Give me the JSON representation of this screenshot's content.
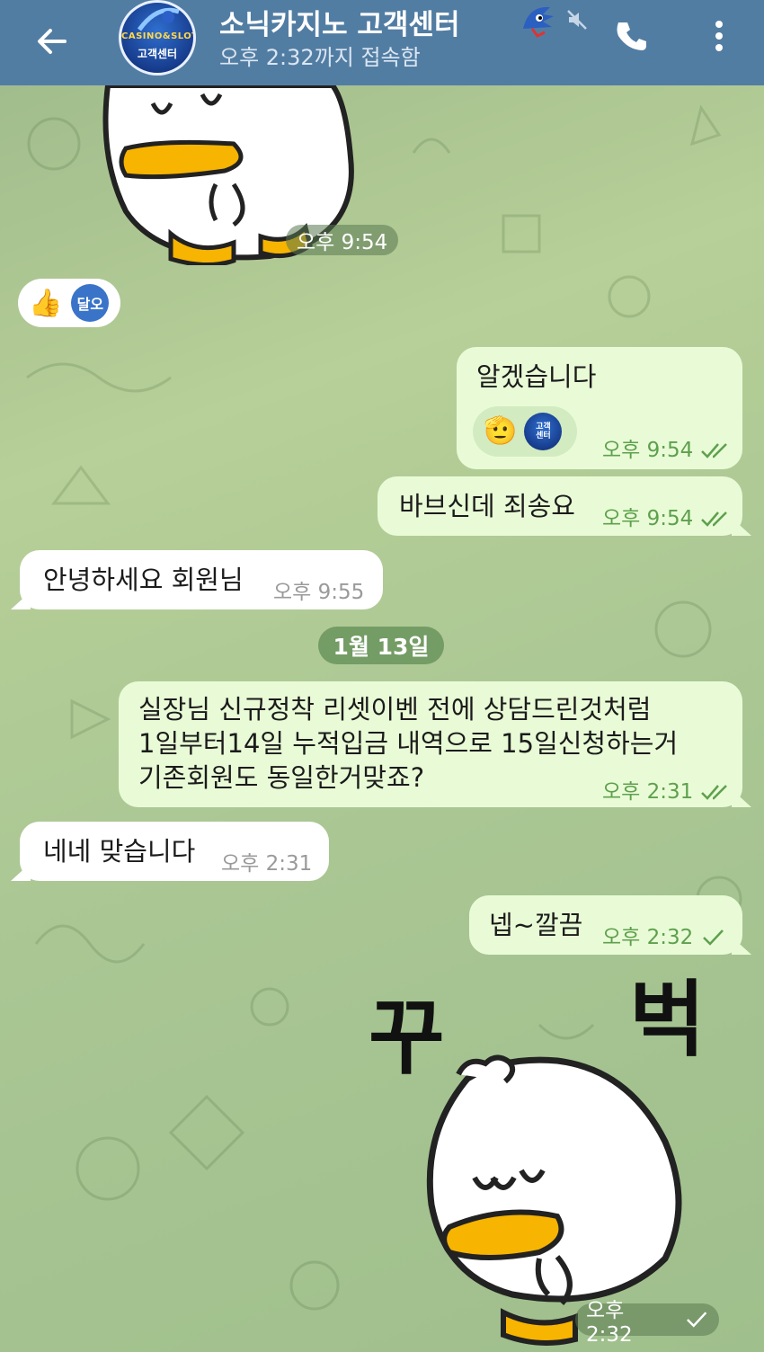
{
  "header": {
    "title": "소닉카지노 고객센터",
    "status": "오후 2:32까지 접속함",
    "avatar_line1": "CASINO&SLOT",
    "avatar_line2": "고객센터",
    "back_icon": "arrow-left-icon",
    "call_icon": "phone-icon",
    "more_icon": "more-vertical-icon",
    "mute_icon": "mute-icon",
    "bg_color": "#527da3"
  },
  "messages": {
    "sticker1_time": "오후 9:54",
    "reaction1": {
      "emoji": "👍",
      "avatar_text": "달오"
    },
    "m1": {
      "text": "알겠습니다",
      "time": "오후 9:54",
      "reaction_emoji": "🫡"
    },
    "m2": {
      "text": "바브신데 죄송요",
      "time": "오후 9:54"
    },
    "m3": {
      "text": "안녕하세요 회원님",
      "time": "오후 9:55"
    },
    "date_divider": "1월 13일",
    "m4": {
      "line1": "실장님 신규정착 리셋이벤 전에 상담드린것처럼",
      "line2": "1일부터14일 누적입금 내역으로 15일신청하는거",
      "line3": "기존회원도 동일한거맞죠?",
      "time": "오후 2:31"
    },
    "m5": {
      "text": "네네 맞습니다",
      "time": "오후 2:31"
    },
    "m6": {
      "text": "넵~깔끔",
      "time": "오후 2:32"
    },
    "sticker2": {
      "text_left": "꾸",
      "text_right": "벅",
      "time": "오후 2:32"
    }
  },
  "colors": {
    "incoming_bubble": "#ffffff",
    "outgoing_bubble": "#e9fbd6",
    "read_check": "#5ea04e"
  }
}
